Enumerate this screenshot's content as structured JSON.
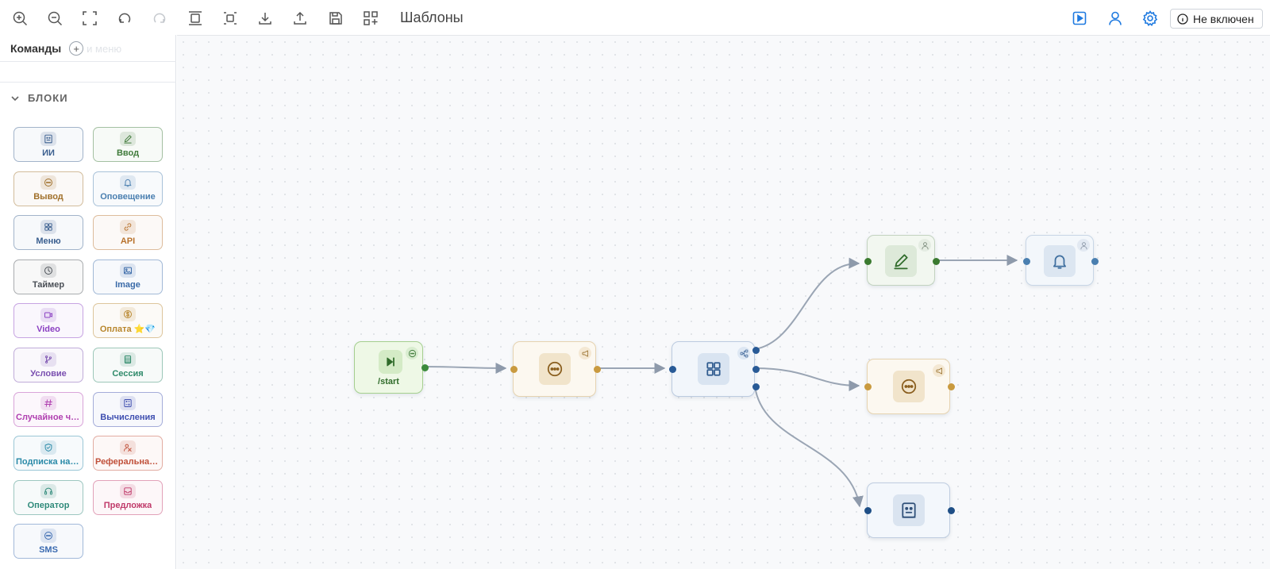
{
  "toolbar": {
    "title": "Шаблоны",
    "icons": [
      "zoom-in-icon",
      "zoom-out-icon",
      "fit-view-icon",
      "undo-icon",
      "redo-icon",
      "align-vertical-icon",
      "distribute-icon",
      "download-icon",
      "upload-icon",
      "save-icon",
      "templates-icon"
    ],
    "right_icons": [
      "play-icon",
      "user-icon",
      "settings-icon"
    ],
    "status_label": "Не включен",
    "accent": "#1f7ae0"
  },
  "sidebar": {
    "commands_title": "Команды",
    "commands_ghost": "и меню",
    "blocks_title": "БЛОКИ",
    "blocks": [
      {
        "label": "ИИ",
        "icon": "ai-robot-icon",
        "color": "#3a5f8f"
      },
      {
        "label": "Ввод",
        "icon": "pencil-icon",
        "color": "#3f7a3a"
      },
      {
        "label": "Вывод",
        "icon": "chat-bubble-icon",
        "color": "#a0702a"
      },
      {
        "label": "Оповещение",
        "icon": "bell-icon",
        "color": "#4a7fb0"
      },
      {
        "label": "Меню",
        "icon": "grid-icon",
        "color": "#3a5f8f"
      },
      {
        "label": "API",
        "icon": "link-icon",
        "color": "#b8722c"
      },
      {
        "label": "Таймер",
        "icon": "clock-icon",
        "color": "#4a4f56"
      },
      {
        "label": "Image",
        "icon": "image-icon",
        "color": "#3a6aa8"
      },
      {
        "label": "Video",
        "icon": "video-icon",
        "color": "#8a3fc2"
      },
      {
        "label": "Оплата ⭐💎",
        "icon": "dollar-icon",
        "color": "#b8862c"
      },
      {
        "label": "Условие",
        "icon": "branch-icon",
        "color": "#7a4fb0"
      },
      {
        "label": "Сессия",
        "icon": "list-icon",
        "color": "#2f8a6a"
      },
      {
        "label": "Случайное число",
        "icon": "hash-icon",
        "color": "#b03fb0"
      },
      {
        "label": "Вычисления",
        "icon": "calculator-icon",
        "color": "#3f4fb0"
      },
      {
        "label": "Подписка на канал",
        "icon": "shield-check-icon",
        "color": "#2a8aa8"
      },
      {
        "label": "Реферальная система",
        "icon": "referral-icon",
        "color": "#c0503a"
      },
      {
        "label": "Оператор",
        "icon": "headset-icon",
        "color": "#2f8a7a"
      },
      {
        "label": "Предложка",
        "icon": "inbox-icon",
        "color": "#c03a6a"
      },
      {
        "label": "SMS",
        "icon": "sms-bubble-icon",
        "color": "#3a6ab0"
      }
    ]
  },
  "canvas": {
    "nodes": [
      {
        "type": "start",
        "label": "/start",
        "icon": "skip-forward-icon",
        "badge": "chat-bubble-icon"
      },
      {
        "type": "output",
        "icon": "chat-bubble-icon",
        "badge": "megaphone-icon"
      },
      {
        "type": "menu",
        "icon": "grid-icon",
        "badge": "share-nodes-icon"
      },
      {
        "type": "input",
        "icon": "pencil-icon",
        "badge": "user-icon"
      },
      {
        "type": "notification",
        "icon": "bell-icon",
        "badge": "user-icon"
      },
      {
        "type": "output",
        "icon": "chat-bubble-icon",
        "badge": "megaphone-icon"
      },
      {
        "type": "ai",
        "icon": "ai-robot-icon"
      }
    ]
  }
}
